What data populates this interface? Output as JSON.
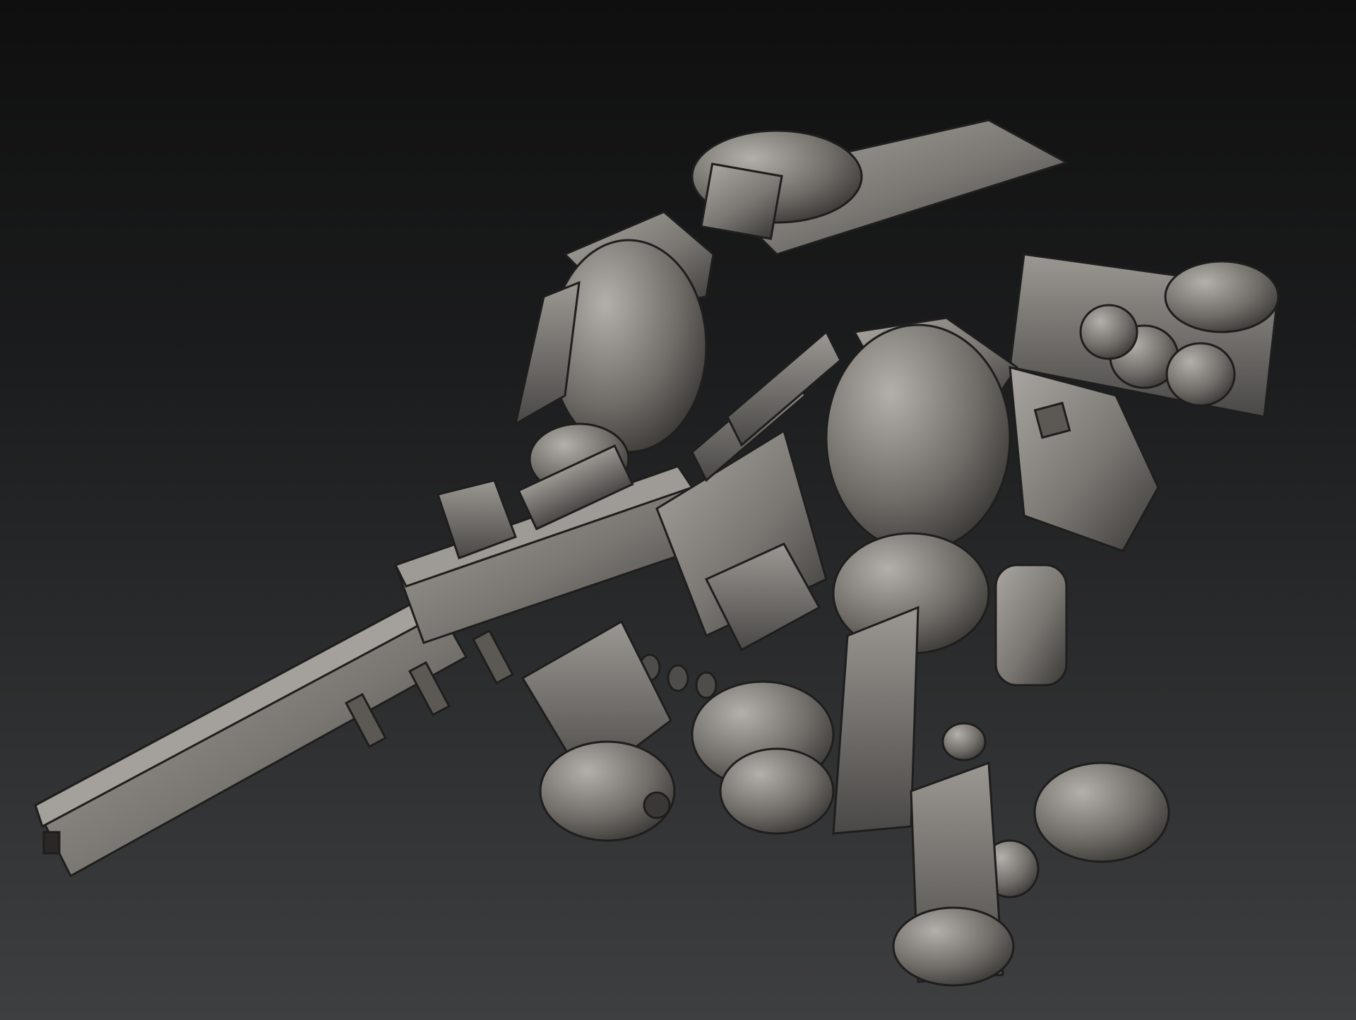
{
  "viewport": {
    "background_top": "#0f0f0f",
    "background_bottom": "#3e3f40"
  },
  "model": {
    "material_color": "#7a7773",
    "highlight_color": "#a9a6a1",
    "shadow_color": "#3a3836",
    "outline_color": "#1f1e1d"
  }
}
